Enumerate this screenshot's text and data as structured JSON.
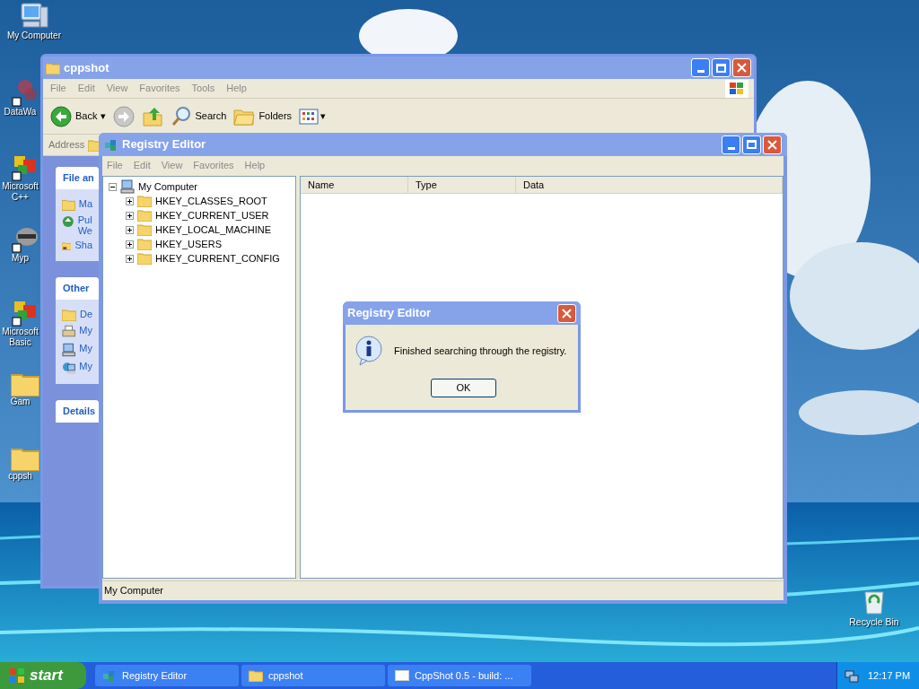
{
  "desktop_icons": [
    {
      "kind": "computer",
      "label": "My Computer"
    },
    {
      "kind": "dots",
      "label": "DataWa"
    },
    {
      "kind": "blocks",
      "label": "Microsoft\nC++"
    },
    {
      "kind": "raccoon",
      "label": "Myp"
    },
    {
      "kind": "blocks",
      "label": "Microsoft\nBasic"
    },
    {
      "kind": "folder",
      "label": "Gam"
    },
    {
      "kind": "folder",
      "label": "cppsh"
    }
  ],
  "recycle_bin": {
    "label": "Recycle Bin"
  },
  "explorer": {
    "title": "cppshot",
    "menu": [
      "File",
      "Edit",
      "View",
      "Favorites",
      "Tools",
      "Help"
    ],
    "toolbar": [
      {
        "kind": "back",
        "label": "Back",
        "dropdown": "▾"
      },
      {
        "kind": "forward"
      },
      {
        "kind": "up"
      },
      {
        "kind": "search",
        "label": "Search"
      },
      {
        "kind": "folders",
        "label": "Folders"
      },
      {
        "kind": "views",
        "dropdown": "▾"
      }
    ],
    "address_label": "Address",
    "task_panels": [
      {
        "title": "File an",
        "items": [
          {
            "kind": "folder",
            "label": "Ma"
          },
          {
            "kind": "globe",
            "label": "Pul\nWe"
          },
          {
            "kind": "share",
            "label": "Sha"
          }
        ]
      },
      {
        "title": "Other",
        "items": [
          {
            "kind": "folder",
            "label": "De"
          },
          {
            "kind": "printer",
            "label": "My"
          },
          {
            "kind": "computer",
            "label": "My"
          },
          {
            "kind": "network",
            "label": "My"
          }
        ]
      },
      {
        "title": "Details"
      }
    ]
  },
  "registry": {
    "title": "Registry Editor",
    "menu": [
      "File",
      "Edit",
      "View",
      "Favorites",
      "Help"
    ],
    "tree": {
      "label": "My Computer",
      "expanded": true,
      "children": [
        {
          "label": "HKEY_CLASSES_ROOT",
          "expanded": false
        },
        {
          "label": "HKEY_CURRENT_USER",
          "expanded": false
        },
        {
          "label": "HKEY_LOCAL_MACHINE",
          "expanded": false
        },
        {
          "label": "HKEY_USERS",
          "expanded": false
        },
        {
          "label": "HKEY_CURRENT_CONFIG",
          "expanded": false
        }
      ]
    },
    "columns": [
      "Name",
      "Type",
      "Data"
    ],
    "status_bar": "My Computer"
  },
  "dialog": {
    "title": "Registry Editor",
    "message": "Finished searching through the registry.",
    "button": "OK"
  },
  "taskbar": {
    "start": "start",
    "buttons": [
      {
        "kind": "registry",
        "label": "Registry Editor",
        "selected": false
      },
      {
        "kind": "folder",
        "label": "cppshot",
        "selected": false
      },
      {
        "kind": "window",
        "label": "CppShot 0.5 - build: ...",
        "selected": false
      }
    ],
    "clock": "12:17 PM"
  }
}
